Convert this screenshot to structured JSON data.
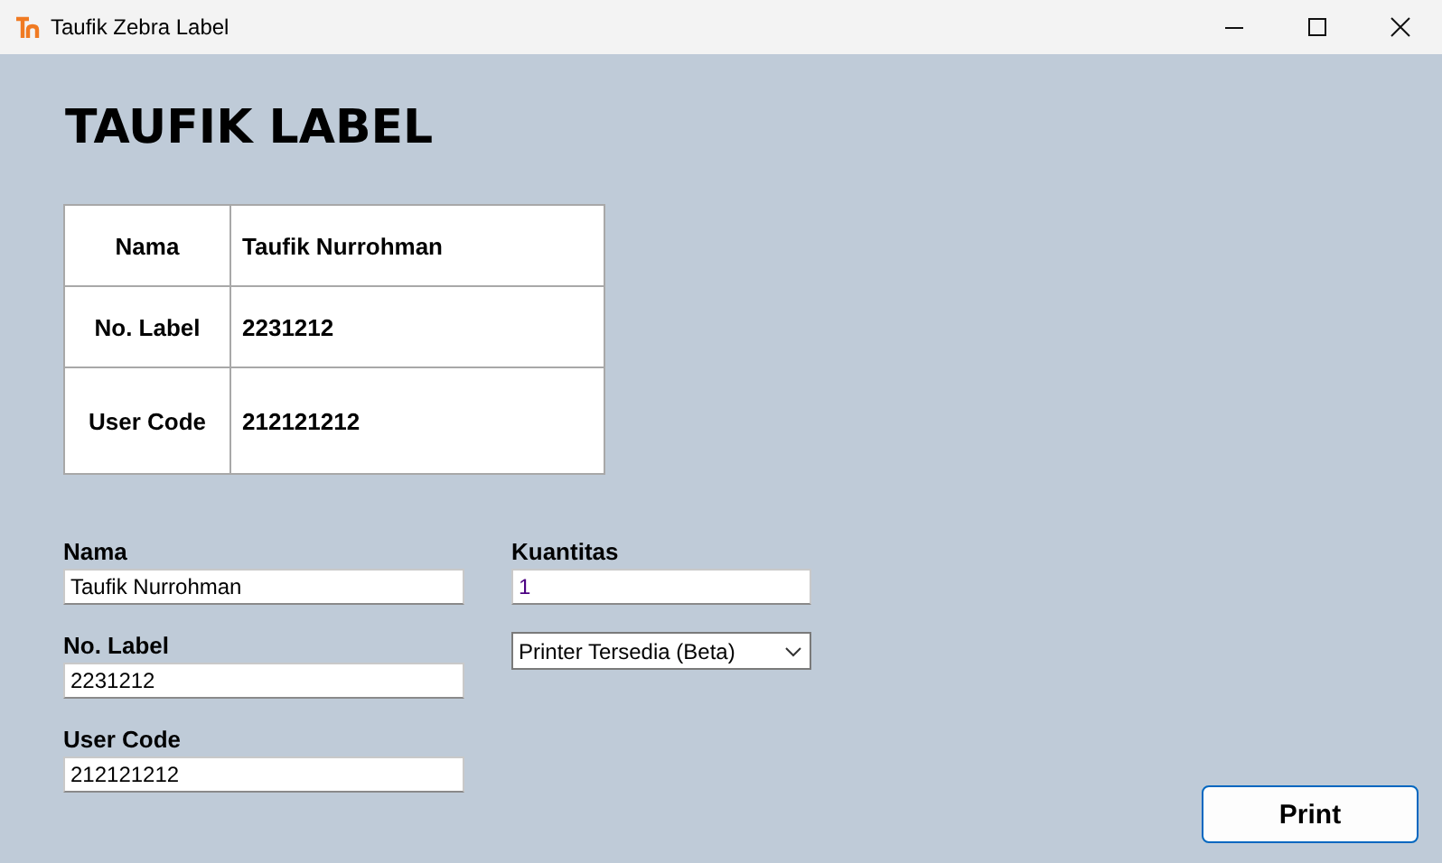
{
  "window": {
    "title": "Taufik Zebra Label"
  },
  "heading": "TAUFIK LABEL",
  "table": {
    "rows": [
      {
        "label": "Nama",
        "value": "Taufik Nurrohman"
      },
      {
        "label": "No. Label",
        "value": "2231212"
      },
      {
        "label": "User Code",
        "value": "212121212"
      }
    ]
  },
  "left_fields": [
    {
      "label": "Nama",
      "value": "Taufik Nurrohman"
    },
    {
      "label": "No. Label",
      "value": "2231212"
    },
    {
      "label": "User Code",
      "value": "212121212"
    }
  ],
  "quantity": {
    "label": "Kuantitas",
    "value": "1"
  },
  "printer_select": {
    "value": "Printer Tersedia (Beta)"
  },
  "print_button": "Print"
}
